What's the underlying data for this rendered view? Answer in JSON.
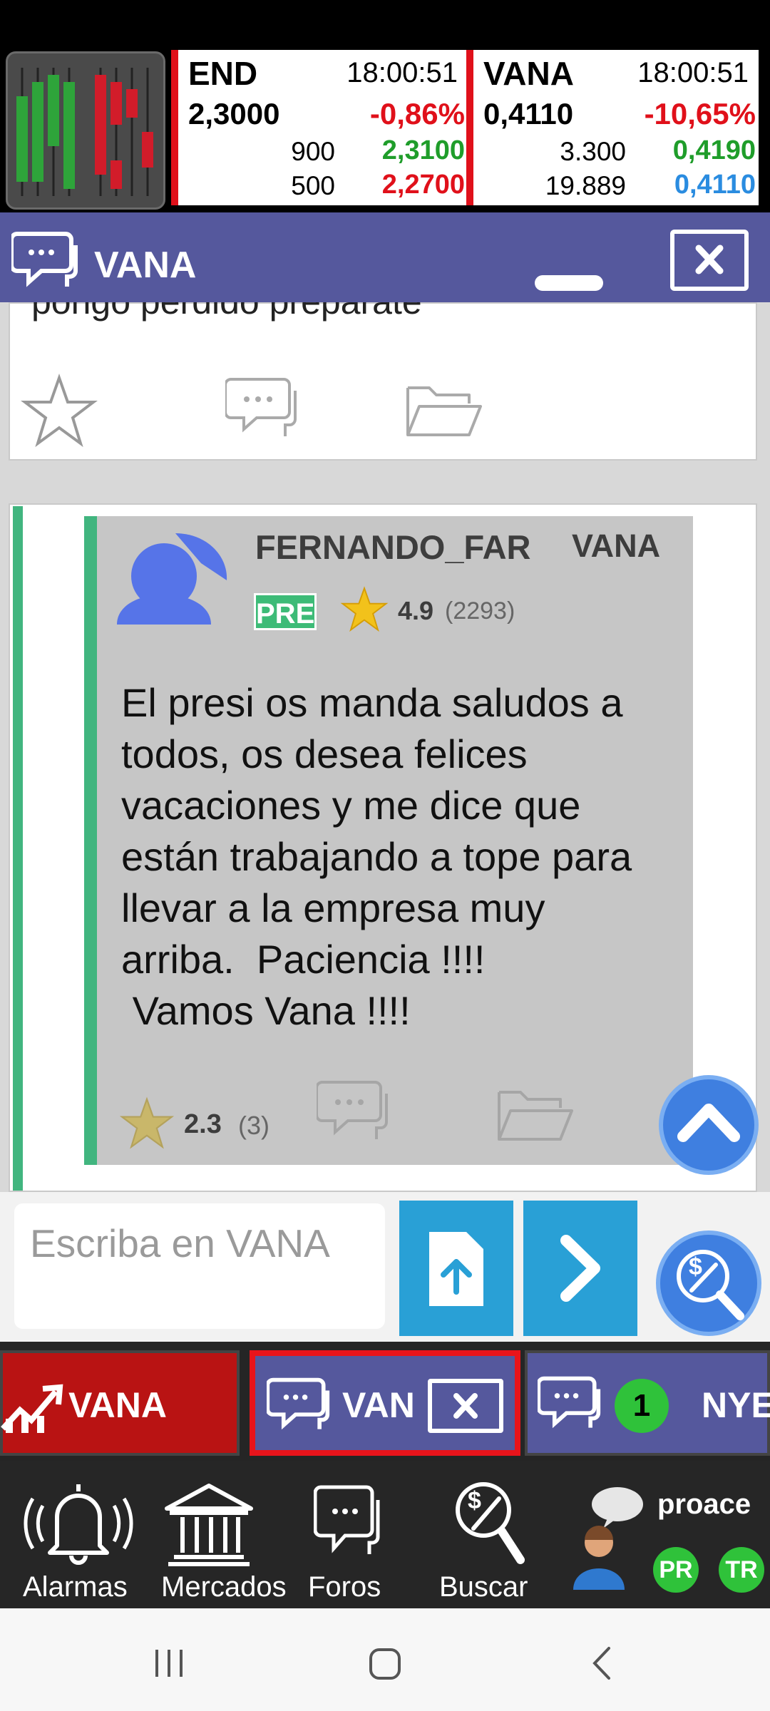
{
  "ticker": [
    {
      "symbol": "END",
      "time": "18:00:51",
      "price": "2,3000",
      "change": "-0,86%",
      "bid_vol": "900",
      "bid": "2,3100",
      "ask_vol": "500",
      "ask": "2,2700"
    },
    {
      "symbol": "VANA",
      "time": "18:00:51",
      "price": "0,4110",
      "change": "-10,65%",
      "bid_vol": "3.300",
      "bid": "0,4190",
      "ask_vol": "19.889",
      "ask": "0,4110"
    }
  ],
  "header": {
    "title": "VANA"
  },
  "prev_post": {
    "text_fragment": "pongo perdido preparate"
  },
  "post": {
    "username": "FERNANDO_FAR",
    "ticker": "VANA",
    "badge": "PRE",
    "user_rating": "4.9",
    "user_rating_count": "(2293)",
    "body": "El presi os manda saludos a\ntodos, os desea felices\nvacaciones y me dice que\nestán trabajando a tope para\nllevar a la empresa muy\narriba.  Paciencia !!!!\n Vamos Vana !!!!",
    "rating": "2.3",
    "rating_count": "(3)"
  },
  "compose": {
    "placeholder": "Escriba en VANA"
  },
  "tabs": [
    {
      "label": "VANA"
    },
    {
      "label": "VAN"
    },
    {
      "label": "NYE",
      "badge": "1"
    }
  ],
  "nav": {
    "alarmas": "Alarmas",
    "mercados": "Mercados",
    "foros": "Foros",
    "buscar": "Buscar",
    "user": "proace",
    "badge_pr": "PR",
    "badge_tr": "TR"
  },
  "colors": {
    "header": "#55589d",
    "accent_green": "#41b57f",
    "accent_red": "#e0101a",
    "button_blue": "#29a0d6"
  }
}
